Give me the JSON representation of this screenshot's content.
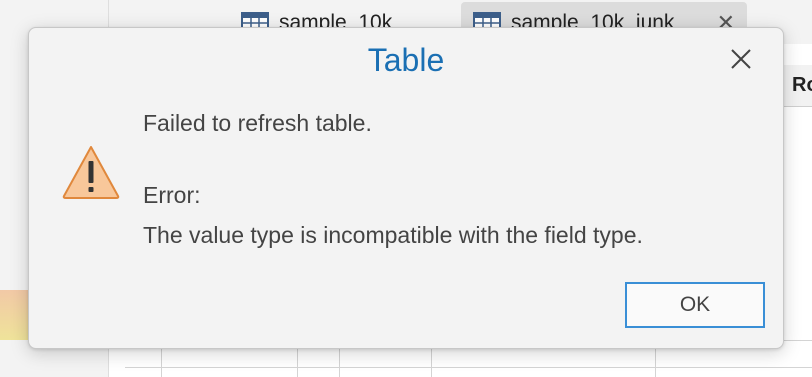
{
  "app": {
    "tabs": [
      {
        "label": "sample_10k",
        "icon": "table-icon"
      },
      {
        "label": "sample_10k_junk",
        "icon": "table-icon"
      }
    ],
    "grid_column_header": "Ro"
  },
  "dialog": {
    "title": "Table",
    "message": "Failed to refresh table.",
    "error_heading": "Error:",
    "error_detail": "The value type is incompatible with the field type.",
    "ok_label": "OK",
    "icon": "warning-icon",
    "close_icon": "close-icon"
  },
  "colors": {
    "title": "#1a6fb3",
    "button_border": "#3a8fd6",
    "warning_fill": "#f8c79a",
    "warning_stroke": "#e0883c"
  }
}
